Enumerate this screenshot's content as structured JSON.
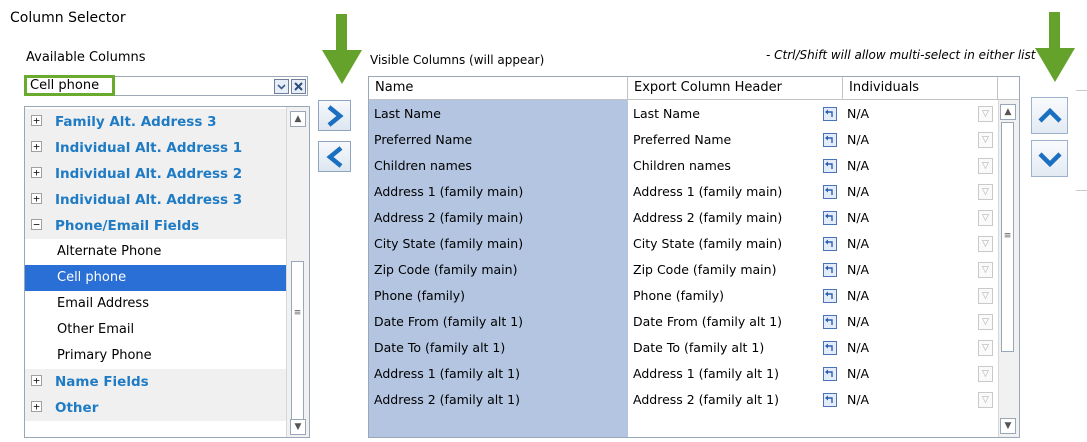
{
  "window": {
    "title": "Column Selector"
  },
  "available": {
    "label": "Available Columns",
    "search_value": "Cell phone",
    "tree": [
      {
        "type": "group",
        "label": "Family Alt. Address 3",
        "expanded": false
      },
      {
        "type": "group",
        "label": "Individual Alt. Address 1",
        "expanded": false
      },
      {
        "type": "group",
        "label": "Individual Alt. Address 2",
        "expanded": false
      },
      {
        "type": "group",
        "label": "Individual Alt. Address 3",
        "expanded": false
      },
      {
        "type": "group",
        "label": "Phone/Email Fields",
        "expanded": true
      },
      {
        "type": "child",
        "label": "Alternate Phone",
        "selected": false
      },
      {
        "type": "child",
        "label": "Cell phone",
        "selected": true
      },
      {
        "type": "child",
        "label": "Email Address",
        "selected": false
      },
      {
        "type": "child",
        "label": "Other Email",
        "selected": false
      },
      {
        "type": "child",
        "label": "Primary Phone",
        "selected": false
      },
      {
        "type": "group",
        "label": "Name Fields",
        "expanded": false
      },
      {
        "type": "group",
        "label": "Other",
        "expanded": false
      }
    ]
  },
  "visible": {
    "label": "Visible Columns (will appear)",
    "hint": "- Ctrl/Shift will allow multi-select in either list",
    "headers": [
      "Name",
      "Export Column Header",
      "Individuals"
    ],
    "rows": [
      {
        "name": "Last Name",
        "export": "Last Name",
        "individuals": "N/A"
      },
      {
        "name": "Preferred Name",
        "export": "Preferred Name",
        "individuals": "N/A"
      },
      {
        "name": "Children names",
        "export": "Children names",
        "individuals": "N/A"
      },
      {
        "name": "Address 1 (family main)",
        "export": "Address 1 (family main)",
        "individuals": "N/A"
      },
      {
        "name": "Address 2 (family main)",
        "export": "Address 2 (family main)",
        "individuals": "N/A"
      },
      {
        "name": "City State (family main)",
        "export": "City State (family main)",
        "individuals": "N/A"
      },
      {
        "name": "Zip Code (family main)",
        "export": "Zip Code (family main)",
        "individuals": "N/A"
      },
      {
        "name": "Phone (family)",
        "export": "Phone (family)",
        "individuals": "N/A"
      },
      {
        "name": "Date From (family alt 1)",
        "export": "Date From (family alt 1)",
        "individuals": "N/A"
      },
      {
        "name": "Date To (family alt 1)",
        "export": "Date To (family alt 1)",
        "individuals": "N/A"
      },
      {
        "name": "Address 1 (family alt 1)",
        "export": "Address 1 (family alt 1)",
        "individuals": "N/A"
      },
      {
        "name": "Address 2 (family alt 1)",
        "export": "Address 2 (family alt 1)",
        "individuals": "N/A"
      }
    ]
  },
  "icons": {
    "move_right": "chevron-right-icon",
    "move_left": "chevron-left-icon",
    "move_up": "chevron-up-icon",
    "move_down": "chevron-down-icon",
    "reset": "reset-header-icon",
    "clear": "clear-x-icon",
    "annotation": "green-arrow-down-icon"
  },
  "colors": {
    "accent_blue": "#1e7bc4",
    "selection": "#2a6fd6",
    "name_column": "#b3c5e1",
    "highlight_green": "#6aab2d",
    "button_arrow": "#1a6fc0"
  }
}
